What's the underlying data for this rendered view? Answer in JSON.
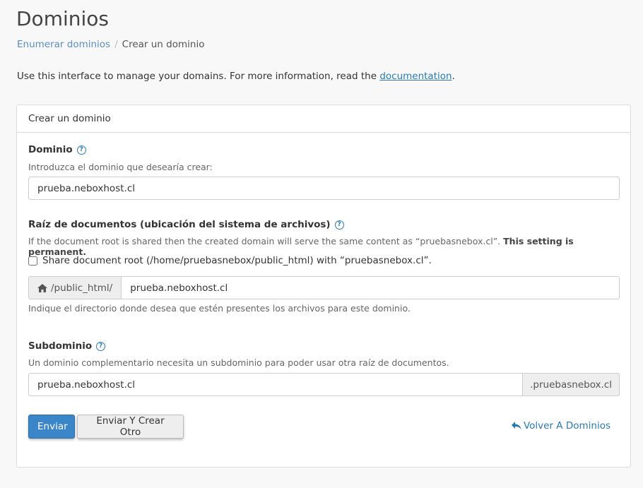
{
  "page": {
    "title": "Dominios",
    "breadcrumb": {
      "parent": "Enumerar dominios",
      "separator": "/",
      "current": "Crear un dominio"
    },
    "intro_text": "Use this interface to manage your domains. For more information, read the ",
    "intro_link": "documentation",
    "intro_end": "."
  },
  "panel": {
    "heading": "Crear un dominio",
    "domain": {
      "label": "Dominio",
      "help_icon": "?",
      "hint": "Introduzca el dominio que desearía crear:",
      "value": "prueba.neboxhost.cl"
    },
    "docroot": {
      "label": "Raíz de documentos (ubicación del sistema de archivos)",
      "help_icon": "?",
      "hint": "If the document root is shared then the created domain will serve the same content as “pruebasnebox.cl”. ",
      "hint_bold": "This setting is permanent.",
      "share_checkbox_label": "Share document root (/home/pruebasnebox/public_html) with “pruebasnebox.cl”.",
      "share_checked": false,
      "prefix": "/public_html/",
      "value": "prueba.neboxhost.cl",
      "below_hint": "Indique el directorio donde desea que estén presentes los archivos para este dominio."
    },
    "subdomain": {
      "label": "Subdominio",
      "help_icon": "?",
      "hint": "Un dominio complementario necesita un subdominio para poder usar otra raíz de documentos.",
      "value": "prueba.neboxhost.cl",
      "suffix": ".pruebasnebox.cl"
    },
    "actions": {
      "submit_label": "Enviar",
      "submit_another_label": "Enviar Y Crear Otro",
      "back_label": "Volver A Dominios"
    }
  },
  "colors": {
    "primary": "#3a86c8",
    "link": "#2a7ab5",
    "background": "#f8f8f8"
  },
  "icons": {
    "help": "question-circle-icon",
    "home": "home-icon",
    "back": "reply-arrow-icon"
  }
}
